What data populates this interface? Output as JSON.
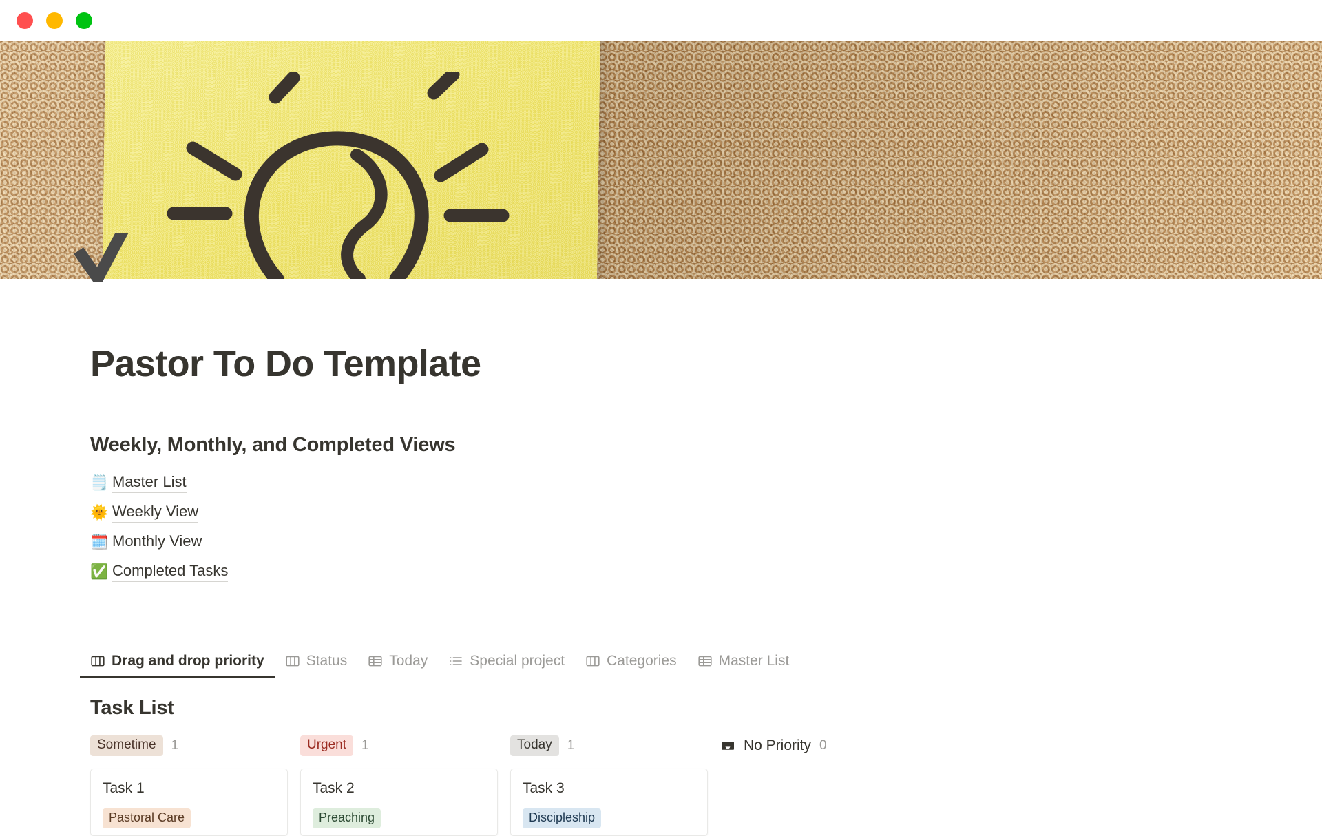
{
  "window": {
    "traffic_lights": [
      {
        "name": "close",
        "color": "#FF4F4F"
      },
      {
        "name": "minimize",
        "color": "#FFB800"
      },
      {
        "name": "zoom",
        "color": "#00C312"
      }
    ]
  },
  "cover": {
    "description": "Yellow sticky note with hand-drawn lightbulb on a cork board",
    "note_color": "#F2E86B",
    "cork_color": "#C79C68",
    "ink_color": "#3B342E"
  },
  "page_icon": {
    "name": "checkmark-icon",
    "color": "#4A4A4A"
  },
  "page": {
    "title": "Pastor To Do Template",
    "section_heading": "Weekly, Monthly, and Completed Views",
    "links": [
      {
        "emoji": "🗒️",
        "icon_name": "spiral-notepad-icon",
        "label": "Master List"
      },
      {
        "emoji": "🌞",
        "icon_name": "sun-icon",
        "label": "Weekly View"
      },
      {
        "emoji": "🗓️",
        "icon_name": "spiral-calendar-icon",
        "label": "Monthly View"
      },
      {
        "emoji": "✅",
        "icon_name": "check-mark-button-icon",
        "label": "Completed Tasks"
      }
    ]
  },
  "tabs": [
    {
      "label": "Drag and drop priority",
      "icon": "board-icon",
      "active": true
    },
    {
      "label": "Status",
      "icon": "board-icon",
      "active": false
    },
    {
      "label": "Today",
      "icon": "table-icon",
      "active": false
    },
    {
      "label": "Special project",
      "icon": "list-icon",
      "active": false
    },
    {
      "label": "Categories",
      "icon": "board-icon",
      "active": false
    },
    {
      "label": "Master List",
      "icon": "table-icon",
      "active": false
    }
  ],
  "board": {
    "title": "Task List",
    "columns": [
      {
        "badge": "Sometime",
        "badge_bg": "#EDE1D7",
        "badge_fg": "#4A342A",
        "count": "1",
        "cards": [
          {
            "title": "Task 1",
            "tag": "Pastoral Care",
            "tag_bg": "#F7E2D2",
            "tag_fg": "#5B3B24"
          }
        ]
      },
      {
        "badge": "Urgent",
        "badge_bg": "#FADEDA",
        "badge_fg": "#9B2C22",
        "count": "1",
        "cards": [
          {
            "title": "Task 2",
            "tag": "Preaching",
            "tag_bg": "#DEEDDD",
            "tag_fg": "#2C4A33"
          }
        ]
      },
      {
        "badge": "Today",
        "badge_bg": "#E3E2E0",
        "badge_fg": "#37352F",
        "count": "1",
        "cards": [
          {
            "title": "Task 3",
            "tag": "Discipleship",
            "tag_bg": "#D8E6F1",
            "tag_fg": "#1F3A52"
          }
        ]
      },
      {
        "badge": "No Priority",
        "badge_bg": "transparent",
        "badge_fg": "#37352F",
        "count": "0",
        "icon": "inbox-icon",
        "cards": []
      }
    ]
  }
}
